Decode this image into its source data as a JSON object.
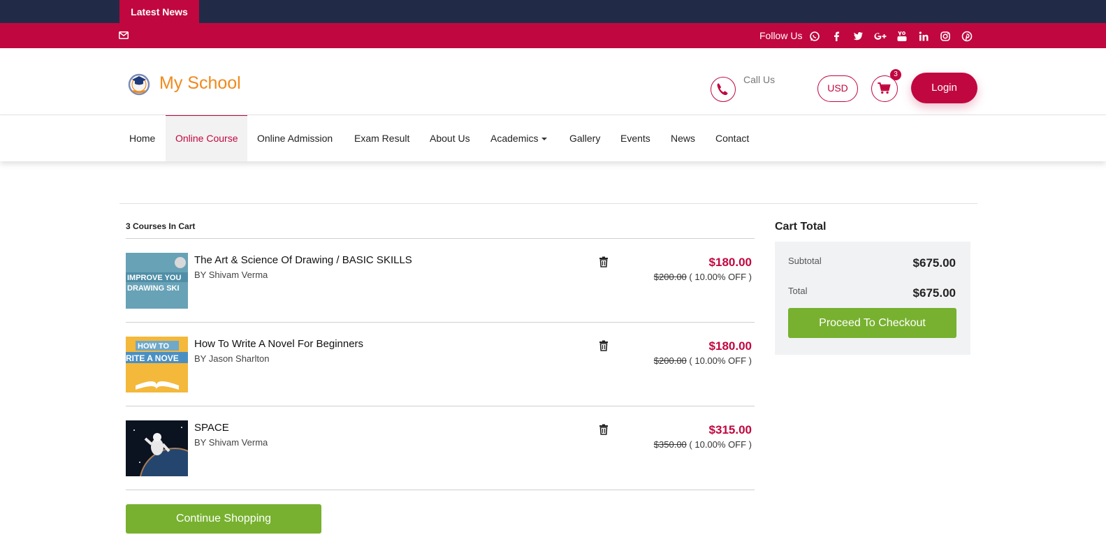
{
  "topbar": {
    "latest_news": "Latest News"
  },
  "socialbar": {
    "follow_label": "Follow Us",
    "icons": [
      "mail-icon",
      "whatsapp-icon",
      "facebook-icon",
      "twitter-icon",
      "google-plus-icon",
      "youtube-icon",
      "linkedin-icon",
      "instagram-icon",
      "pinterest-icon"
    ]
  },
  "header": {
    "brand": "My School",
    "call_label": "Call Us",
    "currency": "USD",
    "cart_count": "3",
    "login": "Login"
  },
  "nav": {
    "items": [
      "Home",
      "Online Course",
      "Online Admission",
      "Exam Result",
      "About Us",
      "Academics",
      "Gallery",
      "Events",
      "News",
      "Contact"
    ],
    "active": "Online Course"
  },
  "cart": {
    "count_label": "3 Courses In Cart",
    "courses": [
      {
        "title": "The Art & Science Of Drawing / BASIC SKILLS",
        "author": "BY Shivam Verma",
        "price": "$180.00",
        "old_price": "$200.00",
        "discount": "( 10.00% OFF )"
      },
      {
        "title": "How To Write A Novel For Beginners",
        "author": "BY Jason Sharlton",
        "price": "$180.00",
        "old_price": "$200.00",
        "discount": "( 10.00% OFF )"
      },
      {
        "title": "SPACE",
        "author": "BY Shivam Verma",
        "price": "$315.00",
        "old_price": "$350.00",
        "discount": "( 10.00% OFF )"
      }
    ],
    "continue": "Continue Shopping"
  },
  "summary": {
    "title": "Cart Total",
    "subtotal_label": "Subtotal",
    "subtotal": "$675.00",
    "total_label": "Total",
    "total": "$675.00",
    "checkout": "Proceed To Checkout"
  },
  "colors": {
    "primary": "#c1073f",
    "navy": "#212b47",
    "green": "#77b12f",
    "brand_orange": "#f08a1c"
  }
}
